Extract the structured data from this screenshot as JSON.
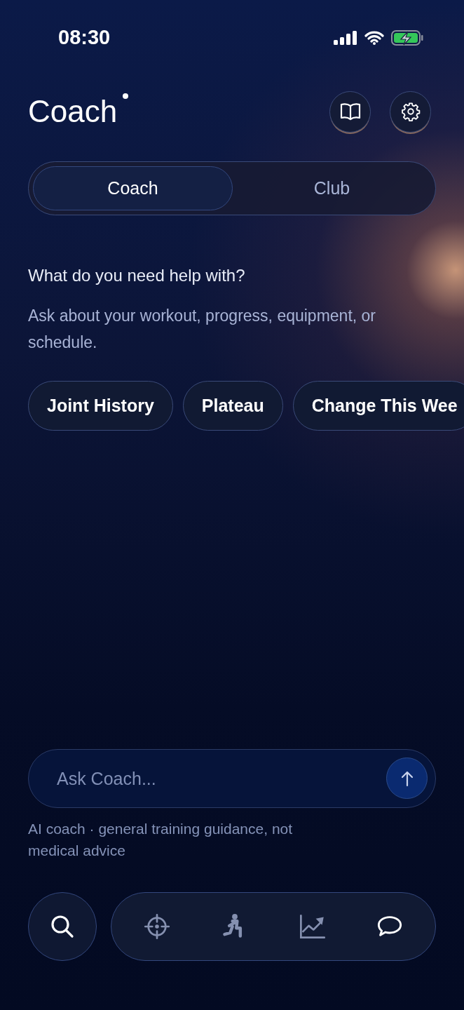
{
  "status_bar": {
    "time": "08:30"
  },
  "header": {
    "title": "Coach"
  },
  "tabs": [
    {
      "label": "Coach",
      "selected": true
    },
    {
      "label": "Club",
      "selected": false
    }
  ],
  "intro": {
    "heading": "What do you need help with?",
    "subtitle": "Ask about your workout, progress, equipment, or schedule."
  },
  "suggestions": [
    "Joint History",
    "Plateau",
    "Change This Wee"
  ],
  "composer": {
    "placeholder": "Ask Coach..."
  },
  "disclaimer": "AI coach · general training guidance, not medical advice",
  "nav": [
    {
      "kind": "target",
      "selected": false
    },
    {
      "kind": "exercise",
      "selected": false
    },
    {
      "kind": "progress",
      "selected": false
    },
    {
      "kind": "chat",
      "selected": true
    }
  ]
}
